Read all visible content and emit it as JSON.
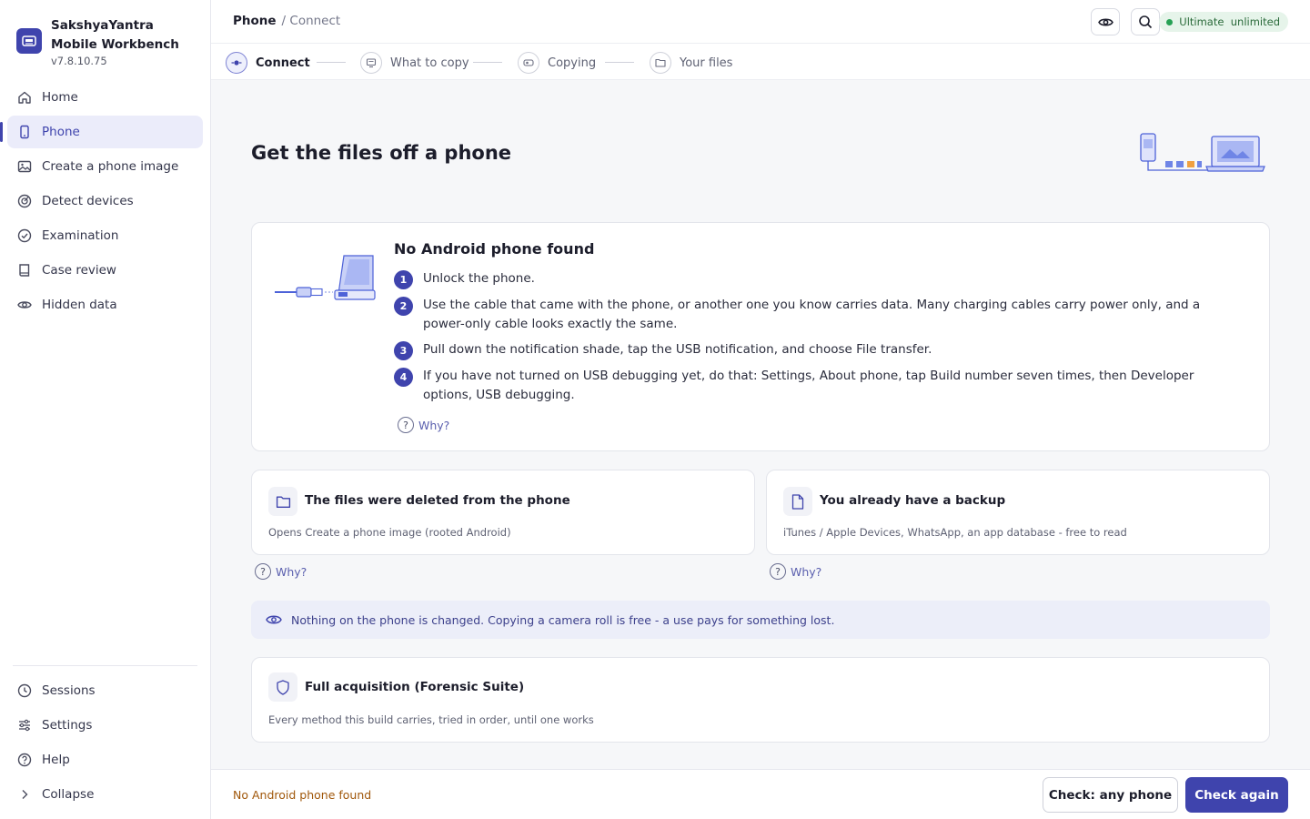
{
  "app": {
    "name": "SakshyaYantra Mobile Workbench",
    "version": "v7.8.10.75"
  },
  "sidebar": {
    "items": [
      {
        "label": "Home",
        "icon": "home-icon"
      },
      {
        "label": "Phone",
        "icon": "phone-icon",
        "active": true
      },
      {
        "label": "Create a phone image",
        "icon": "image-icon"
      },
      {
        "label": "Detect devices",
        "icon": "radar-icon"
      },
      {
        "label": "Examination",
        "icon": "check-circle-icon"
      },
      {
        "label": "Case review",
        "icon": "book-icon"
      },
      {
        "label": "Hidden data",
        "icon": "eye-icon"
      }
    ],
    "bottom": [
      {
        "label": "Sessions",
        "icon": "clock-icon"
      },
      {
        "label": "Settings",
        "icon": "sliders-icon"
      },
      {
        "label": "Help",
        "icon": "help-icon"
      },
      {
        "label": "Collapse",
        "icon": "chevron-right-icon"
      }
    ]
  },
  "header": {
    "breadcrumb": {
      "section": "Phone",
      "page": "/ Connect"
    },
    "plan_badge": "Ultimate  unlimited"
  },
  "stepper": {
    "steps": [
      {
        "label": "Connect",
        "active": true
      },
      {
        "label": "What to copy"
      },
      {
        "label": "Copying"
      },
      {
        "label": "Your files"
      }
    ]
  },
  "main": {
    "title": "Get the files off a phone",
    "no_phone": {
      "title": "No Android phone found",
      "steps": [
        {
          "n": "1",
          "text": "Unlock the phone."
        },
        {
          "n": "2",
          "text": "Use the cable that came with the phone, or another one you know carries data. Many charging cables carry power only, and a power-only cable looks exactly the same."
        },
        {
          "n": "3",
          "text": "Pull down the notification shade, tap the USB notification, and choose File transfer."
        },
        {
          "n": "4",
          "text": "If you have not turned on USB debugging yet, do that: Settings, About phone, tap Build number seven times, then Developer options, USB debugging."
        }
      ],
      "why": "Why?"
    },
    "options": [
      {
        "title": "The files were deleted from the phone",
        "subtitle": "Opens Create a phone image (rooted Android)",
        "why": "Why?"
      },
      {
        "title": "You already have a backup",
        "subtitle": "iTunes / Apple Devices, WhatsApp, an app database - free to read",
        "why": "Why?"
      }
    ],
    "notice": "Nothing on the phone is changed. Copying a camera roll is free - a use pays for something lost.",
    "full_acquisition": {
      "title": "Full acquisition (Forensic Suite)",
      "subtitle": "Every method this build carries, tried in order, until one works"
    }
  },
  "footer": {
    "status": "No Android phone found",
    "secondary_button": "Check: any phone",
    "primary_button": "Check again"
  },
  "colors": {
    "accent": "#3f44ad",
    "accent_soft": "#ebecfa",
    "warning_text": "#a0570a",
    "badge_bg": "#e6f4ea",
    "badge_dot": "#26a154"
  }
}
